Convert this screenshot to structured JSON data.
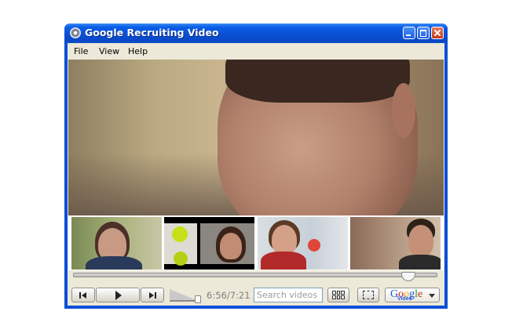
{
  "window": {
    "title": "Google Recruiting Video",
    "controls": [
      "minimize",
      "maximize",
      "close"
    ]
  },
  "menu": {
    "items": [
      "File",
      "View",
      "Help"
    ]
  },
  "player": {
    "progress_fraction": 0.94,
    "time_display": "6:56/7:21",
    "volume_fraction": 1.0,
    "search_placeholder": "Search videos",
    "brand": {
      "logo_text": "Google",
      "sub_text": "Video"
    }
  },
  "thumbnails": [
    {
      "name": "woman-with-glasses-outdoors"
    },
    {
      "name": "woman-with-tennis-balls"
    },
    {
      "name": "woman-with-glasses-office"
    },
    {
      "name": "man-in-crowd"
    }
  ],
  "colors": {
    "title_bar": "#0b50d6",
    "window_frame": "#0b4fd8",
    "chrome_bg": "#ece9d8",
    "close_button": "#d24726"
  },
  "icons": {
    "app": "disc-icon",
    "prev": "skip-back-icon",
    "play": "play-icon",
    "next": "skip-forward-icon",
    "grid": "grid-view-icon",
    "fullscreen": "fullscreen-icon",
    "dropdown": "chevron-down-icon"
  }
}
